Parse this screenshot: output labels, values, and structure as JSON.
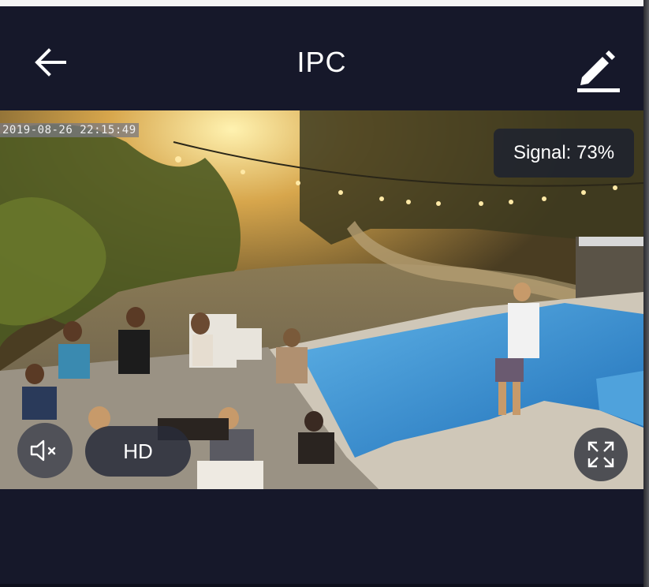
{
  "header": {
    "title": "IPC",
    "back_icon": "arrow-left-icon",
    "edit_icon": "pencil-icon"
  },
  "video": {
    "timestamp": "2019-08-26 22:15:49",
    "signal_text": "Signal: 73%",
    "quality_label": "HD",
    "mute_icon": "speaker-muted-icon",
    "fullscreen_icon": "expand-icon"
  },
  "colors": {
    "background": "#16182a",
    "overlay": "#1c2130",
    "text": "#ffffff"
  }
}
